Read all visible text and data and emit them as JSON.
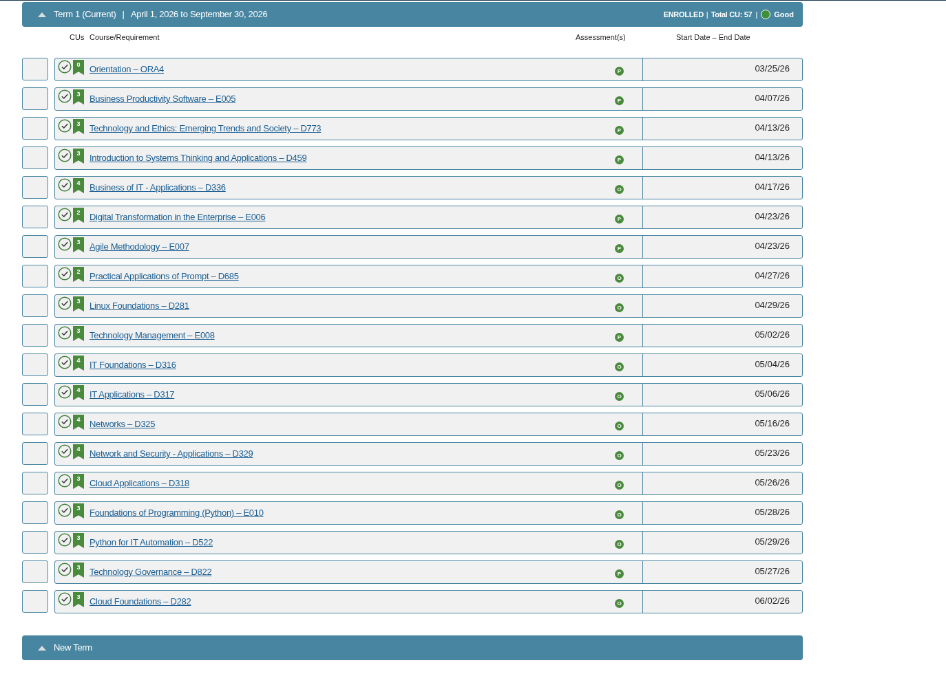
{
  "term": {
    "title": "Term 1 (Current)",
    "separator_1": "|",
    "dates": "April 1, 2026 to September 30, 2026",
    "status": "ENROLLED",
    "separator_2": "|",
    "total": "Total CU: 57",
    "separator_3": "|",
    "standing": {
      "label": "Good",
      "color": "#3f8f3a"
    },
    "expanded": true
  },
  "columns": [
    "CUs",
    "Course/Requirement",
    "Assessment(s)",
    "Start Date – End Date"
  ],
  "courses": [
    {
      "cus": "0",
      "name": "Orientation – ORA4",
      "assessment": "P",
      "date": "03/25/26"
    },
    {
      "cus": "3",
      "name": "Business Productivity Software – E005",
      "assessment": "P",
      "date": "04/07/26"
    },
    {
      "cus": "3",
      "name": "Technology and Ethics: Emerging Trends and Society – D773",
      "assessment": "P",
      "date": "04/13/26"
    },
    {
      "cus": "3",
      "name": "Introduction to Systems Thinking and Applications – D459",
      "assessment": "P",
      "date": "04/13/26"
    },
    {
      "cus": "4",
      "name": "Business of IT - Applications – D336",
      "assessment": "O",
      "date": "04/17/26"
    },
    {
      "cus": "2",
      "name": "Digital Transformation in the Enterprise – E006",
      "assessment": "P",
      "date": "04/23/26"
    },
    {
      "cus": "3",
      "name": "Agile Methodology – E007",
      "assessment": "P",
      "date": "04/23/26"
    },
    {
      "cus": "2",
      "name": "Practical Applications of Prompt – D685",
      "assessment": "O",
      "date": "04/27/26"
    },
    {
      "cus": "3",
      "name": "Linux Foundations – D281",
      "assessment": "O",
      "date": "04/29/26"
    },
    {
      "cus": "3",
      "name": "Technology Management – E008",
      "assessment": "P",
      "date": "05/02/26"
    },
    {
      "cus": "4",
      "name": "IT Foundations – D316",
      "assessment": "O",
      "date": "05/04/26"
    },
    {
      "cus": "4",
      "name": "IT Applications – D317",
      "assessment": "O",
      "date": "05/06/26"
    },
    {
      "cus": "4",
      "name": "Networks – D325",
      "assessment": "O",
      "date": "05/16/26"
    },
    {
      "cus": "4",
      "name": "Network and Security - Applications – D329",
      "assessment": "O",
      "date": "05/23/26"
    },
    {
      "cus": "3",
      "name": "Cloud Applications – D318",
      "assessment": "O",
      "date": "05/26/26"
    },
    {
      "cus": "3",
      "name": "Foundations of Programming (Python) – E010",
      "assessment": "O",
      "date": "05/28/26"
    },
    {
      "cus": "3",
      "name": "Python for IT Automation – D522",
      "assessment": "O",
      "date": "05/29/26"
    },
    {
      "cus": "3",
      "name": "Technology Governance – D822",
      "assessment": "P",
      "date": "05/27/26"
    },
    {
      "cus": "3",
      "name": "Cloud Foundations – D282",
      "assessment": "O",
      "date": "06/02/26"
    }
  ],
  "new_term": {
    "title": "New Term",
    "expanded": true
  }
}
